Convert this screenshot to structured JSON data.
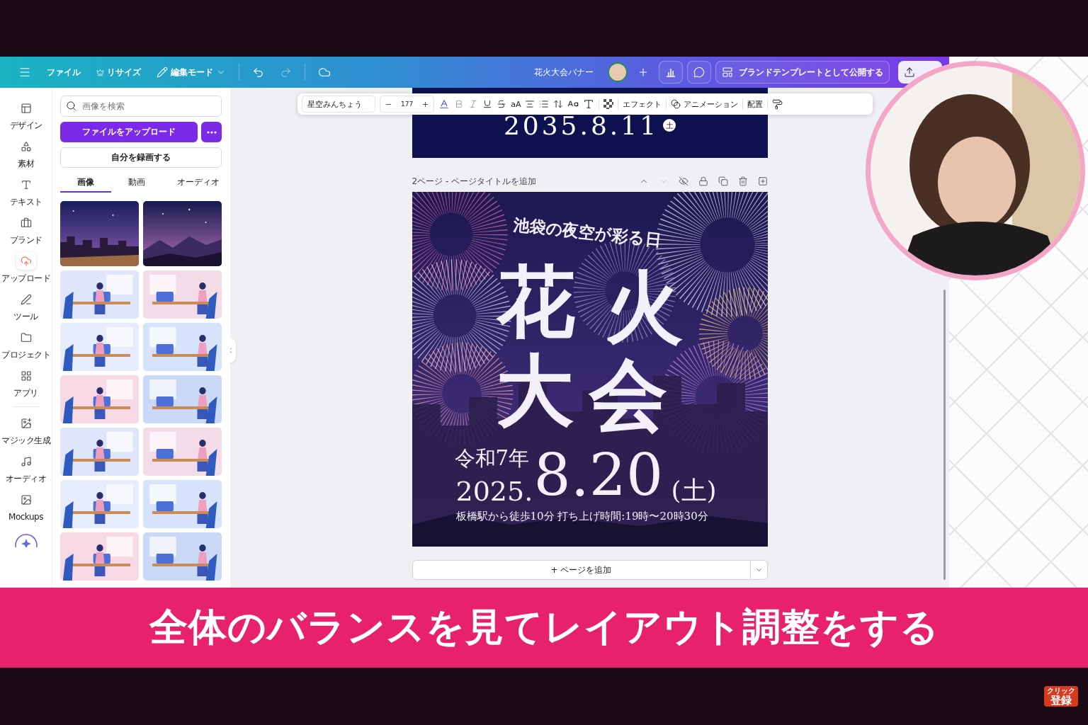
{
  "topbar": {
    "file": "ファイル",
    "resize": "リサイズ",
    "mode": "編集モード",
    "undo": {
      "disabled": false
    },
    "redo": {
      "disabled": true
    },
    "title": "花火大会バナー",
    "publish": "ブランドテンプレートとして公開する"
  },
  "rail": [
    {
      "label": "デザイン",
      "selected": false
    },
    {
      "label": "素材",
      "selected": false
    },
    {
      "label": "テキスト",
      "selected": false
    },
    {
      "label": "ブランド",
      "selected": false
    },
    {
      "label": "アップロード",
      "selected": true
    },
    {
      "label": "ツール",
      "selected": false
    },
    {
      "label": "プロジェクト",
      "selected": false
    },
    {
      "label": "アプリ",
      "selected": false
    },
    {
      "label": "マジック生成",
      "selected": false
    },
    {
      "label": "オーディオ",
      "selected": false
    },
    {
      "label": "Mockups",
      "selected": false
    }
  ],
  "panel": {
    "search": {
      "placeholder": "画像を検索"
    },
    "upload": "ファイルをアップロード",
    "record": "自分を録画する",
    "tabs": [
      {
        "label": "画像",
        "selected": true
      },
      {
        "label": "動画",
        "selected": false
      },
      {
        "label": "オーディオ",
        "selected": false
      }
    ]
  },
  "text_toolbar": {
    "font": "星空みんちょう",
    "size": "177",
    "case": "aA",
    "effects": "エフェクト",
    "animation": "アニメーション",
    "position": "配置"
  },
  "previous_page": {
    "date": "2035.8.11",
    "weekday": "土"
  },
  "page": {
    "header": "2ページ - ページタイトルを追加",
    "poster": {
      "subtitle": "池袋の夜空が彩る日",
      "title_chars": [
        "花",
        "火",
        "大",
        "会"
      ],
      "era": "令和7年",
      "year": "2025.",
      "date": "8.20",
      "weekday": "(土)",
      "info": "板橋駅から徒歩10分  打ち上げ時間:19時〜20時30分"
    }
  },
  "add_page": "+ ページを追加",
  "caption": "全体のバランスを見てレイアウト調整をする",
  "subscribe_badge": {
    "top": "クリック",
    "bottom": "登録"
  }
}
